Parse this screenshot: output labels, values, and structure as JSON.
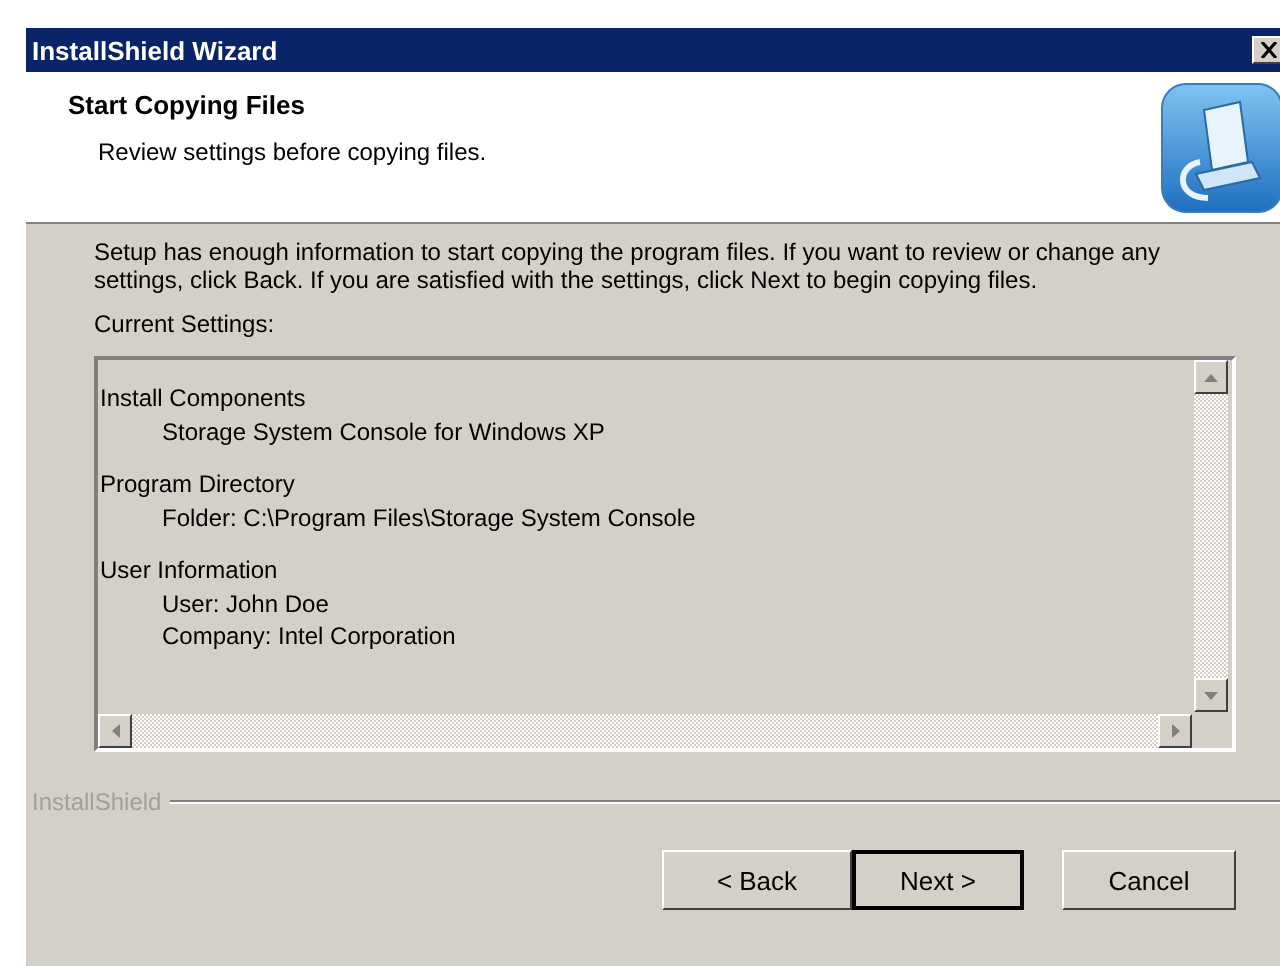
{
  "window": {
    "title": "InstallShield Wizard"
  },
  "header": {
    "title": "Start Copying Files",
    "subtitle": "Review settings before copying files."
  },
  "intro": "Setup has enough information to start copying the program files.  If you want to review or change any settings, click Back.  If you are satisfied with the settings, click Next to begin copying files.",
  "settings_label": "Current Settings:",
  "settings": [
    {
      "heading": "Install Components",
      "lines": [
        "Storage System Console for Windows XP"
      ]
    },
    {
      "heading": "Program Directory",
      "lines": [
        "Folder:  C:\\Program Files\\Storage System Console"
      ]
    },
    {
      "heading": "User Information",
      "lines": [
        "User:  John Doe",
        "Company:   Intel Corporation"
      ]
    }
  ],
  "brand": "InstallShield",
  "buttons": [
    {
      "label": "< Back",
      "default": false
    },
    {
      "label": "Next >",
      "default": true
    },
    {
      "label": "Cancel",
      "default": false
    }
  ]
}
